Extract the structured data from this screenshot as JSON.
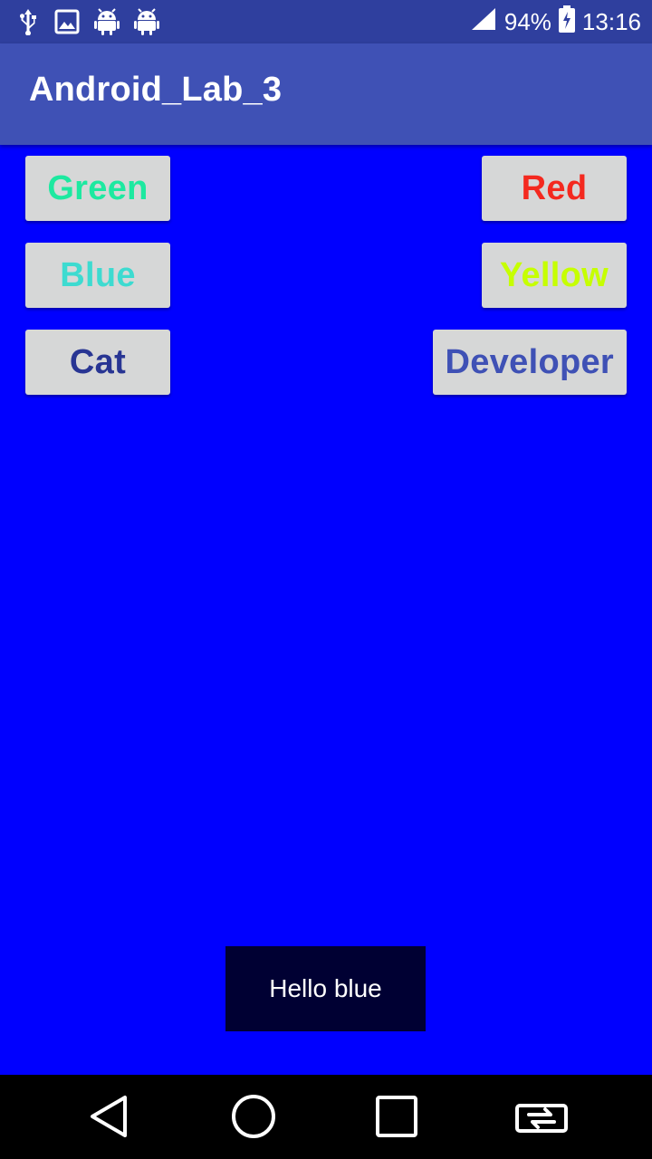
{
  "status_bar": {
    "icons": [
      "usb-icon",
      "image-icon",
      "android-icon",
      "android-icon",
      "signal-icon",
      "battery-charging-icon"
    ],
    "battery": "94%",
    "time": "13:16"
  },
  "app_bar": {
    "title": "Android_Lab_3"
  },
  "buttons": {
    "green": {
      "label": "Green",
      "color": "#1de9a0"
    },
    "red": {
      "label": "Red",
      "color": "#f4291f"
    },
    "blue": {
      "label": "Blue",
      "color": "#3ddbd0"
    },
    "yellow": {
      "label": "Yellow",
      "color": "#c6ff00"
    },
    "cat": {
      "label": "Cat",
      "color": "#283593"
    },
    "developer": {
      "label": "Developer",
      "color": "#3f51b5"
    }
  },
  "toast": {
    "text": "Hello blue"
  },
  "colors": {
    "background": "#0000ff",
    "status_bar": "#2f3f9e",
    "app_bar": "#3f51b5",
    "button_bg": "#d6d7d7",
    "toast_bg": "#000033"
  },
  "nav_bar": {
    "icons": [
      "back-icon",
      "home-icon",
      "recents-icon",
      "rotate-icon"
    ]
  }
}
